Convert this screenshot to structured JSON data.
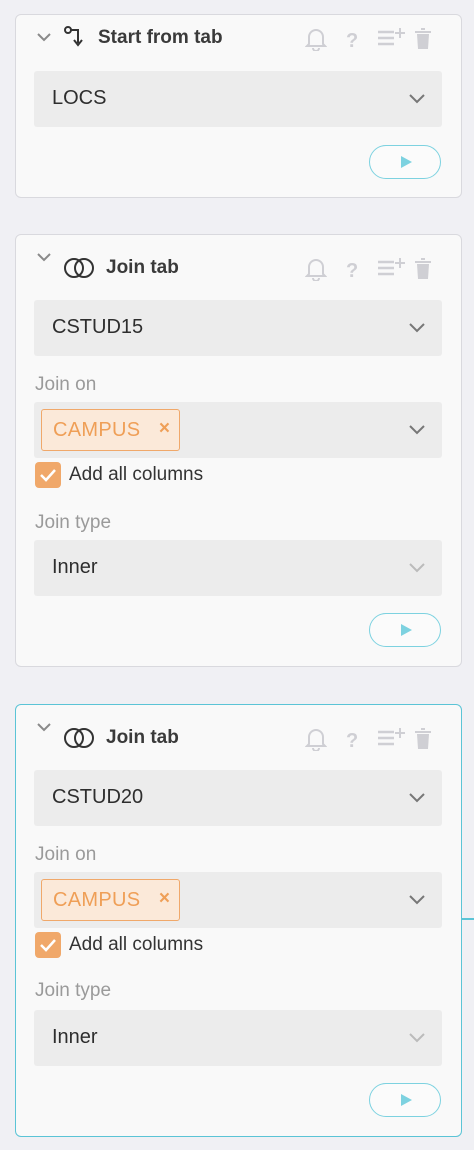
{
  "steps": [
    {
      "title": "Start from tab",
      "icon": "branch-arrow-icon",
      "table_value": "LOCS"
    },
    {
      "title": "Join tab",
      "icon": "venn-join-icon",
      "table_value": "CSTUD15",
      "join_on_label": "Join on",
      "join_on_chip": "CAMPUS",
      "chip_remove": "×",
      "add_all_columns_label": "Add all columns",
      "add_all_columns_checked": true,
      "join_type_label": "Join type",
      "join_type_value": "Inner"
    },
    {
      "title": "Join tab",
      "icon": "venn-join-icon",
      "table_value": "CSTUD20",
      "join_on_label": "Join on",
      "join_on_chip": "CAMPUS",
      "chip_remove": "×",
      "add_all_columns_label": "Add all columns",
      "add_all_columns_checked": true,
      "join_type_label": "Join type",
      "join_type_value": "Inner",
      "active": true
    }
  ],
  "colors": {
    "accent": "#5bc4d6",
    "chip_border": "#f0a86a",
    "chip_text": "#ef9f57",
    "checkbox": "#f0a86a",
    "field_bg": "#ececec",
    "icon_muted": "#cfcfd4"
  }
}
